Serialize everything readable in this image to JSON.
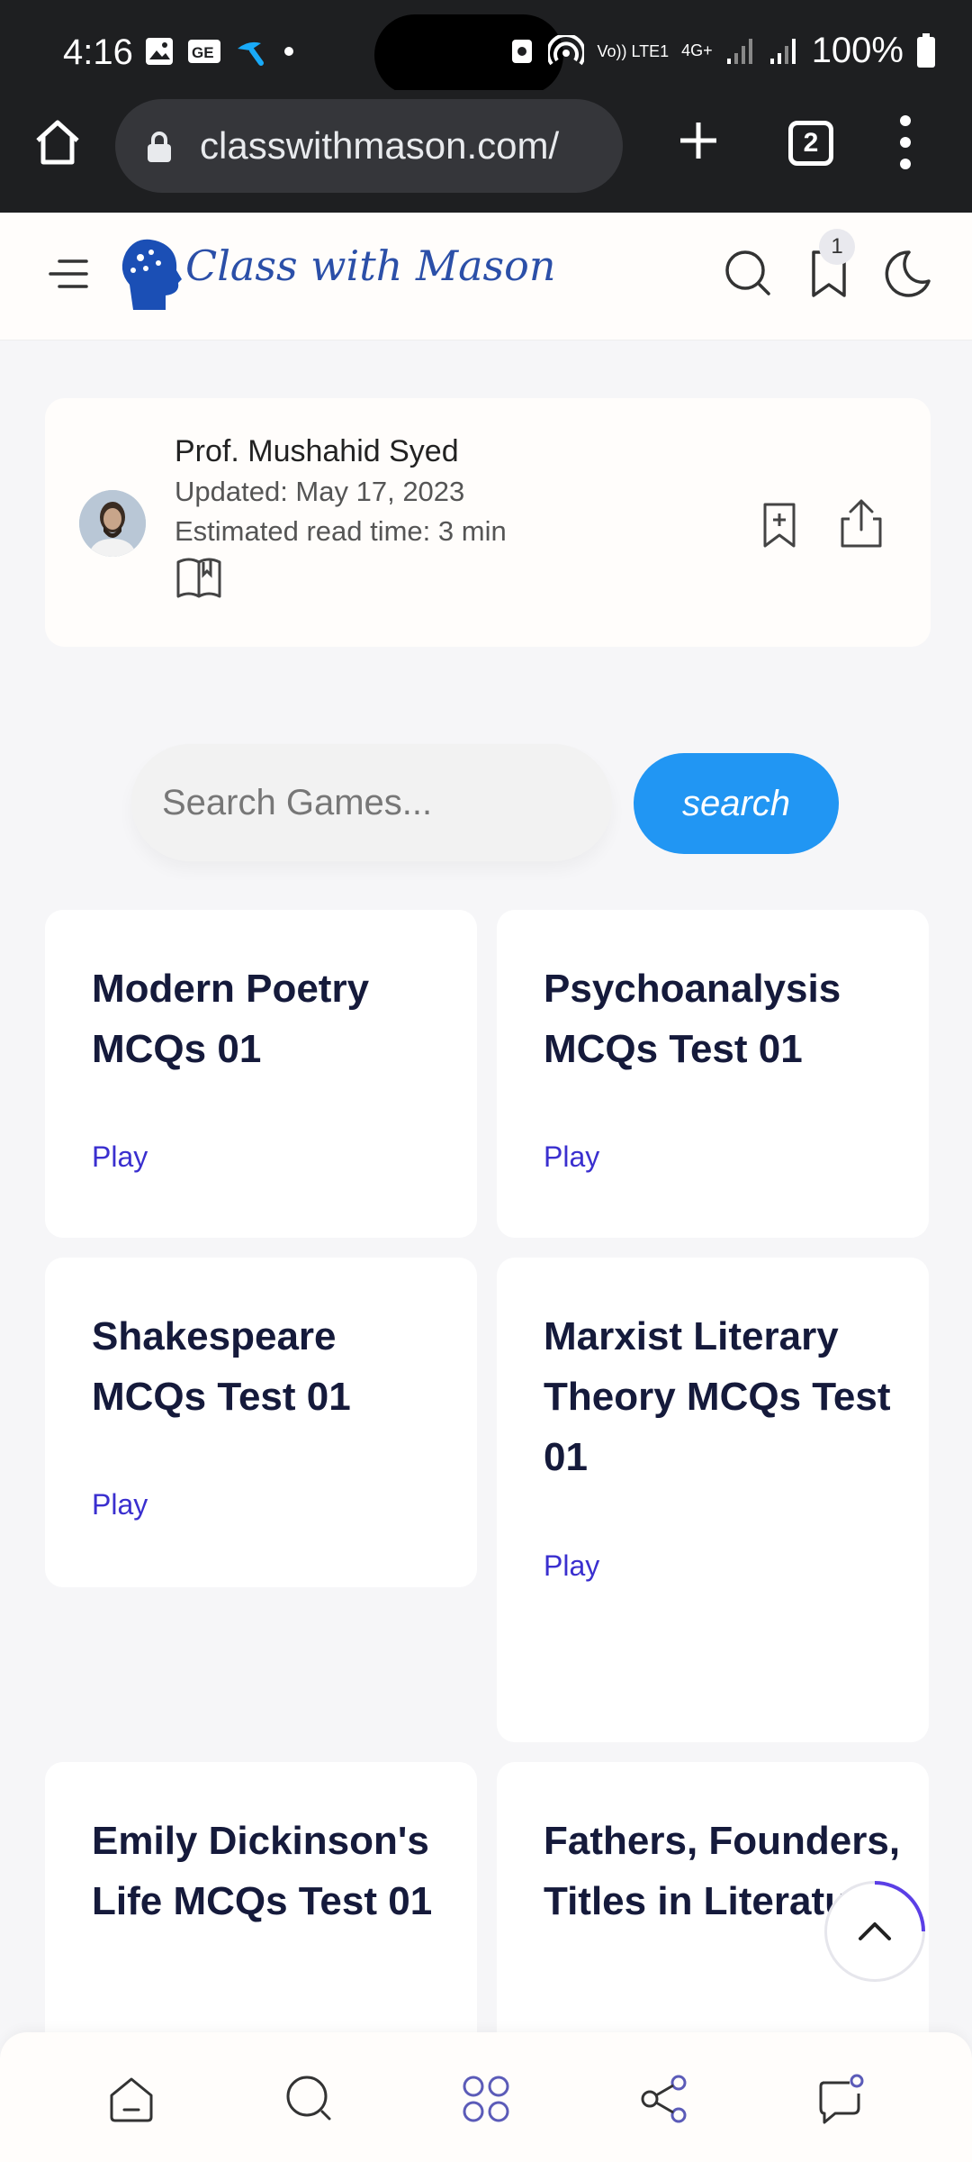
{
  "status_bar": {
    "time": "4:16",
    "network_labels": [
      "Vo)) LTE1",
      "4G+"
    ],
    "battery": "100%"
  },
  "browser": {
    "url": "classwithmason.com/",
    "tab_count": "2"
  },
  "site": {
    "logo_text": "Class with Mason",
    "bookmark_badge": "1"
  },
  "author_card": {
    "name": "Prof. Mushahid Syed",
    "updated": "Updated: May 17, 2023",
    "read_time": "Estimated read time: 3 min"
  },
  "search": {
    "placeholder": "Search Games...",
    "button_label": "search"
  },
  "games": [
    {
      "title": "Modern Poetry MCQs 01",
      "play": "Play"
    },
    {
      "title": "Psychoanalysis MCQs Test 01",
      "play": "Play"
    },
    {
      "title": "Shakespeare MCQs Test 01",
      "play": "Play"
    },
    {
      "title": "Marxist Literary Theory MCQs Test 01",
      "play": "Play"
    },
    {
      "title": "Emily Dickinson's Life MCQs Test 01",
      "play": ""
    },
    {
      "title": "Fathers, Founders, Titles in Literature",
      "play": ""
    }
  ],
  "colors": {
    "accent": "#2196f3",
    "play_link": "#3a2fcf",
    "title_text": "#151a3b",
    "browser_chrome": "#1e1f21"
  },
  "icons": [
    "home-icon",
    "lock-icon",
    "plus-icon",
    "tabs-icon",
    "more-vert-icon",
    "menu-icon",
    "search-icon",
    "bookmark-icon",
    "moon-icon",
    "book-icon",
    "bookmark-add-icon",
    "share-icon",
    "chevron-up-icon",
    "chat-icon",
    "grid-icon"
  ]
}
